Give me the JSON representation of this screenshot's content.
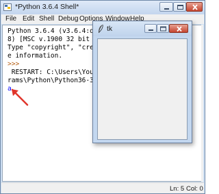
{
  "shell": {
    "title": "*Python 3.6.4 Shell*",
    "menu": [
      "File",
      "Edit",
      "Shell",
      "Debug",
      "Options",
      "Window",
      "Help"
    ],
    "lines": [
      "Python 3.6.4 (v3.6.4:d48",
      "8) [MSC v.1900 32 bit (I",
      "Type \"copyright\", \"credi",
      "e information.",
      ">>> ",
      " RESTART: C:\\Users\\Youne",
      "rams\\Python\\Python36-32\\",
      "a"
    ],
    "status": {
      "line": "Ln: 5",
      "col": "Col: 0"
    },
    "icons": {
      "app": "python-idle-icon",
      "minimize": "minimize-icon",
      "maximize": "maximize-icon",
      "close": "close-icon",
      "annotation": "red-arrow-icon"
    }
  },
  "tk": {
    "title": "tk",
    "icons": {
      "app": "tk-feather-icon",
      "minimize": "minimize-icon",
      "maximize": "maximize-icon",
      "close": "close-icon"
    }
  },
  "colors": {
    "prompt": "#b35a0d",
    "output": "#0000ff",
    "arrow": "#e0352b",
    "close_button": "#c4442f"
  }
}
